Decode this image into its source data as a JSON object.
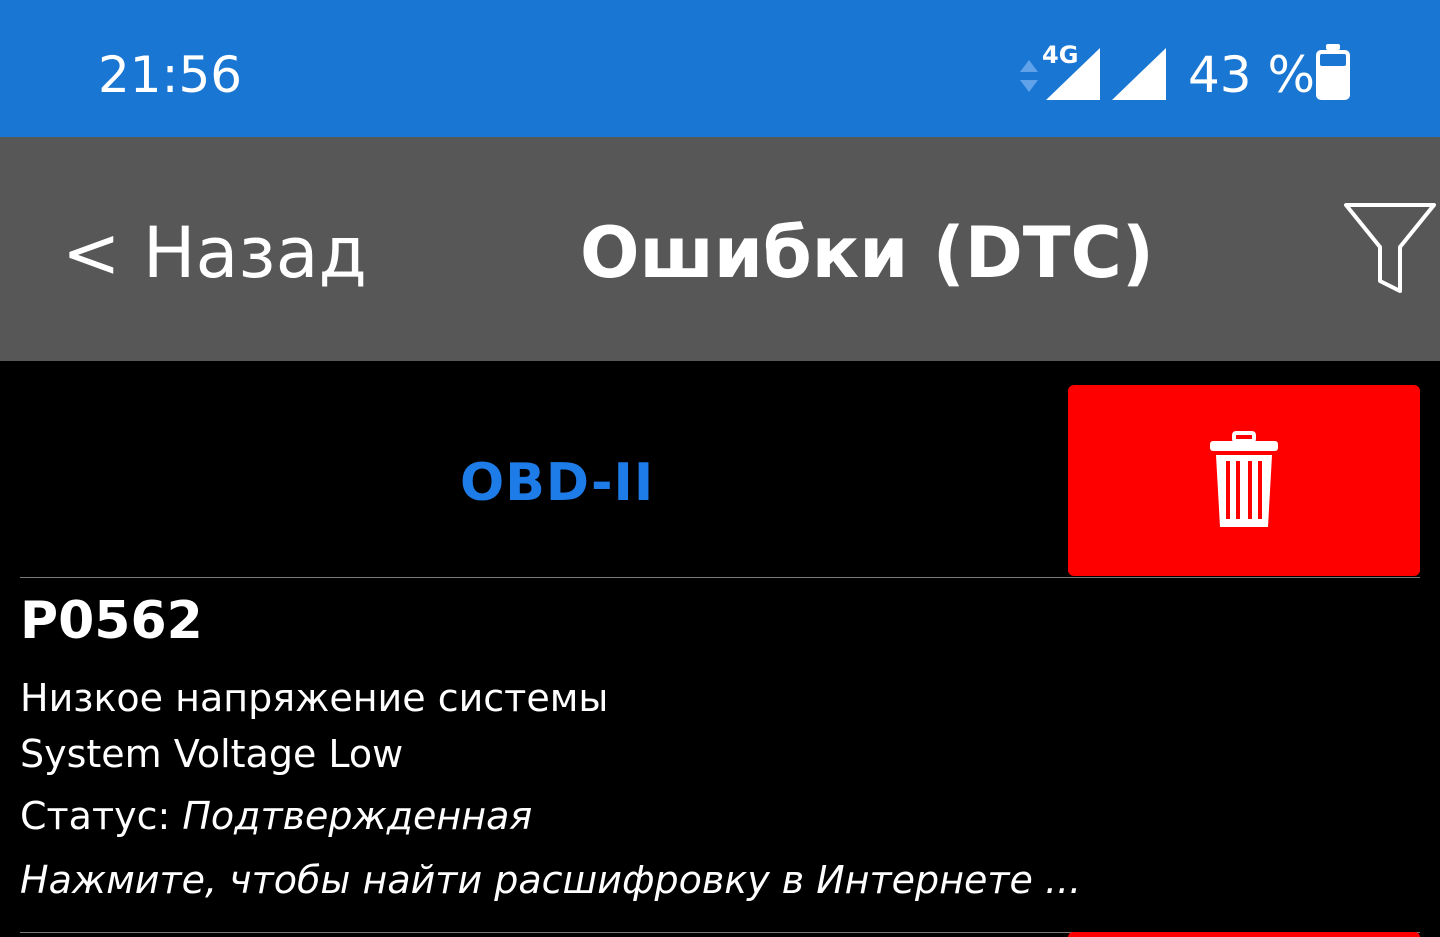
{
  "status_bar": {
    "time": "21:56",
    "network_type": "4G",
    "battery_percent": "43 %",
    "icons": [
      "data-arrows-icon",
      "signal-4g-icon",
      "signal-icon",
      "battery-icon"
    ]
  },
  "nav": {
    "back_label": "< Назад",
    "title": "Ошибки (DTC)",
    "filter_icon": "filter-icon"
  },
  "section": {
    "label": "OBD-II",
    "delete_icon": "trash-icon"
  },
  "dtc_items": [
    {
      "code": "P0562",
      "description_ru": "Низкое напряжение системы",
      "description_en": "System Voltage Low",
      "status_label": "Статус: ",
      "status_value": "Подтвержденная",
      "hint": "Нажмите, чтобы найти расшифровку в Интернете ..."
    }
  ],
  "colors": {
    "status_bar": "#1976d2",
    "nav_bar": "#575757",
    "background": "#000000",
    "section_label": "#1e7ce8",
    "delete_button": "#ff0000",
    "text": "#ffffff"
  }
}
